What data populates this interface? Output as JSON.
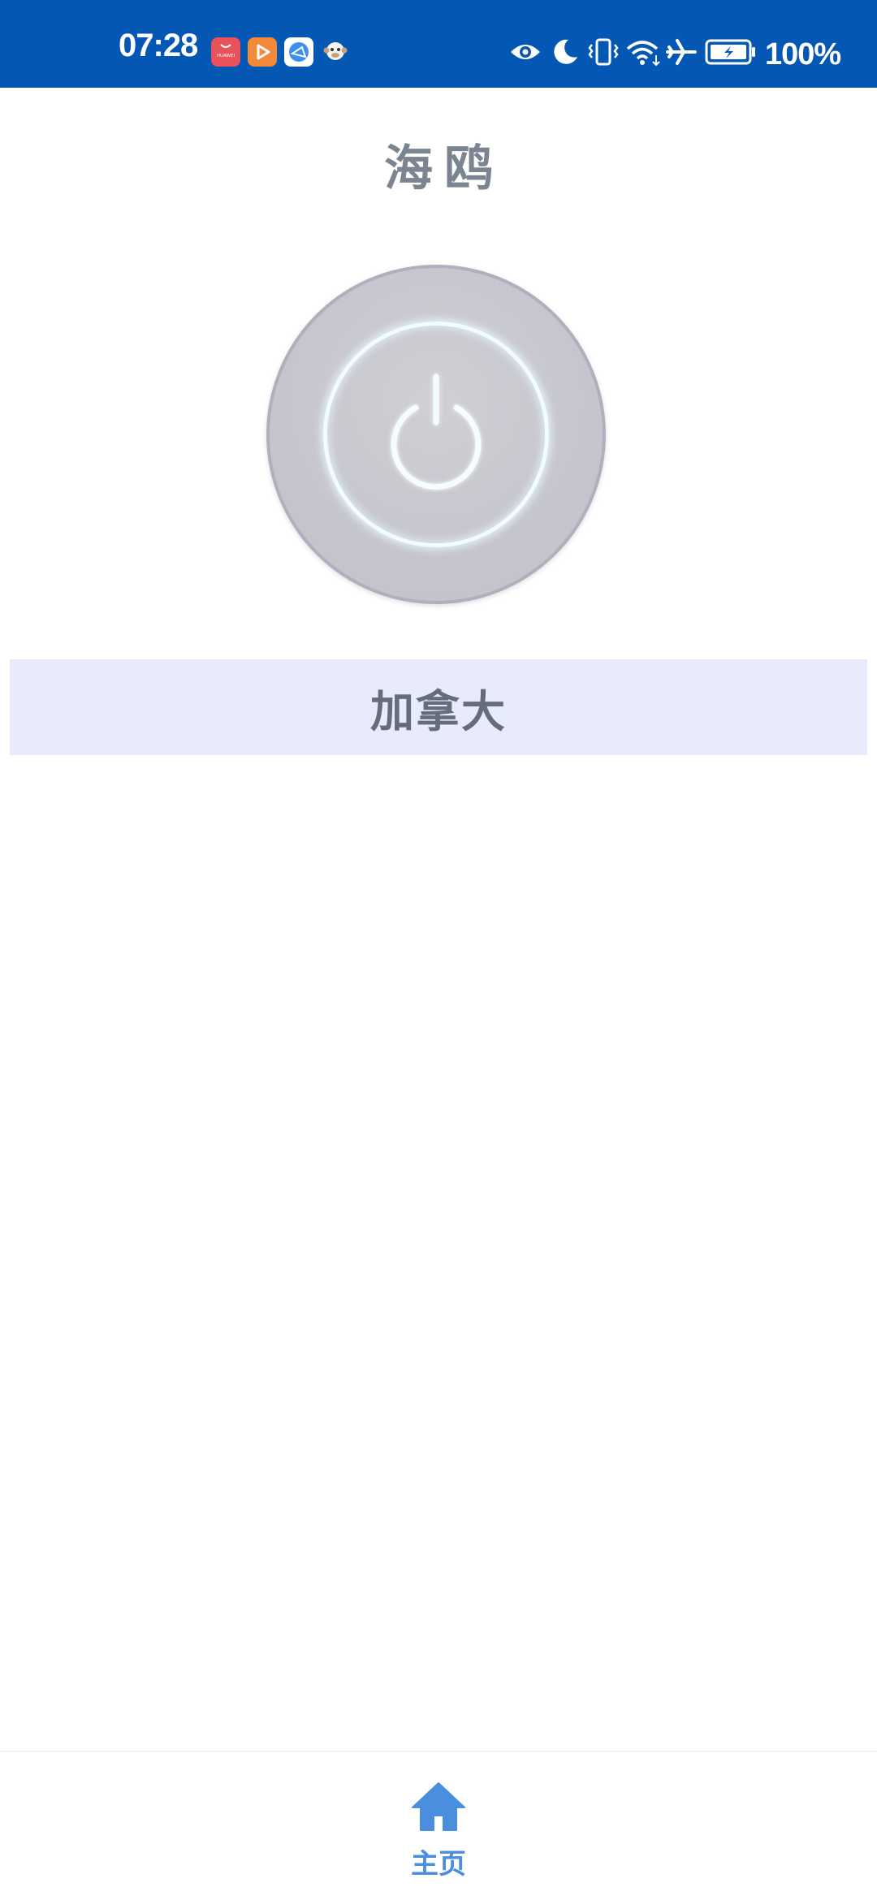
{
  "status_bar": {
    "time": "07:28",
    "battery_percent": "100%",
    "notification_icons": [
      "huawei-appgallery-icon",
      "video-play-icon",
      "browser-icon",
      "monkey-app-icon"
    ],
    "system_icons": [
      "eye-comfort-icon",
      "moon-icon",
      "vibrate-icon",
      "wifi-icon",
      "airplane-icon",
      "battery-charging-icon"
    ],
    "notification_icon_text": "HUAWEI",
    "background_color": "#0557b4"
  },
  "app": {
    "title": "海鸥"
  },
  "power": {
    "icon": "power-icon",
    "state": "off"
  },
  "server": {
    "selected": "加拿大"
  },
  "bottom_nav": {
    "items": [
      {
        "label": "主页",
        "icon": "home-icon",
        "active": true
      }
    ],
    "active_color": "#4a8ee0"
  }
}
